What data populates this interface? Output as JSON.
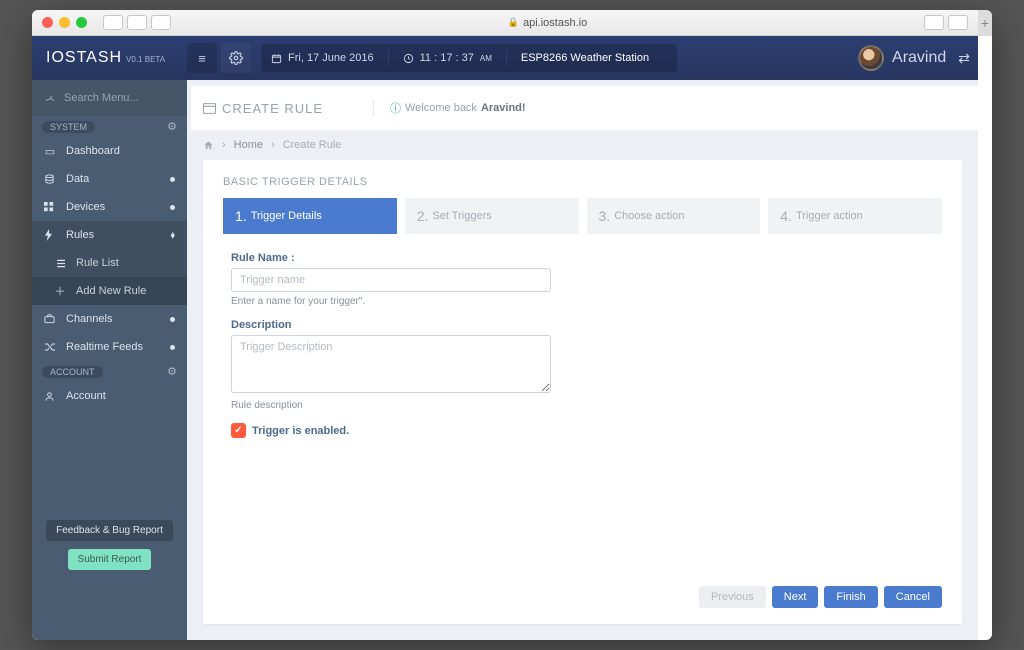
{
  "browser": {
    "url": "api.iostash.io"
  },
  "brand": {
    "name": "IOSTASH",
    "version": "V0.1 BETA"
  },
  "topbar": {
    "date": "Fri, 17 June 2016",
    "time": "11 : 17 : 37",
    "time_suffix": "AM",
    "device": "ESP8266 Weather Station",
    "user": "Aravind"
  },
  "search": {
    "placeholder": "Search Menu..."
  },
  "sections": {
    "system_label": "SYSTEM",
    "account_label": "ACCOUNT"
  },
  "nav": {
    "dashboard": "Dashboard",
    "data": "Data",
    "devices": "Devices",
    "rules": "Rules",
    "rule_list": "Rule List",
    "add_rule": "Add New Rule",
    "channels": "Channels",
    "realtime": "Realtime Feeds",
    "account": "Account"
  },
  "sidebar_buttons": {
    "feedback": "Feedback & Bug Report",
    "submit": "Submit Report"
  },
  "page": {
    "title": "CREATE RULE",
    "welcome_prefix": "Welcome back ",
    "welcome_name": "Aravind!"
  },
  "breadcrumb": {
    "home": "Home",
    "current": "Create Rule"
  },
  "panel": {
    "title": "BASIC TRIGGER DETAILS"
  },
  "steps": {
    "s1": "Trigger Details",
    "s2": "Set Triggers",
    "s3": "Choose action",
    "s4": "Trigger action"
  },
  "form": {
    "rule_name_label": "Rule Name :",
    "rule_name_placeholder": "Trigger name",
    "rule_name_help": "Enter a name for your trigger\".",
    "description_label": "Description",
    "description_placeholder": "Trigger Description",
    "description_help": "Rule description",
    "enabled_label": "Trigger is enabled."
  },
  "buttons": {
    "previous": "Previous",
    "next": "Next",
    "finish": "Finish",
    "cancel": "Cancel"
  }
}
